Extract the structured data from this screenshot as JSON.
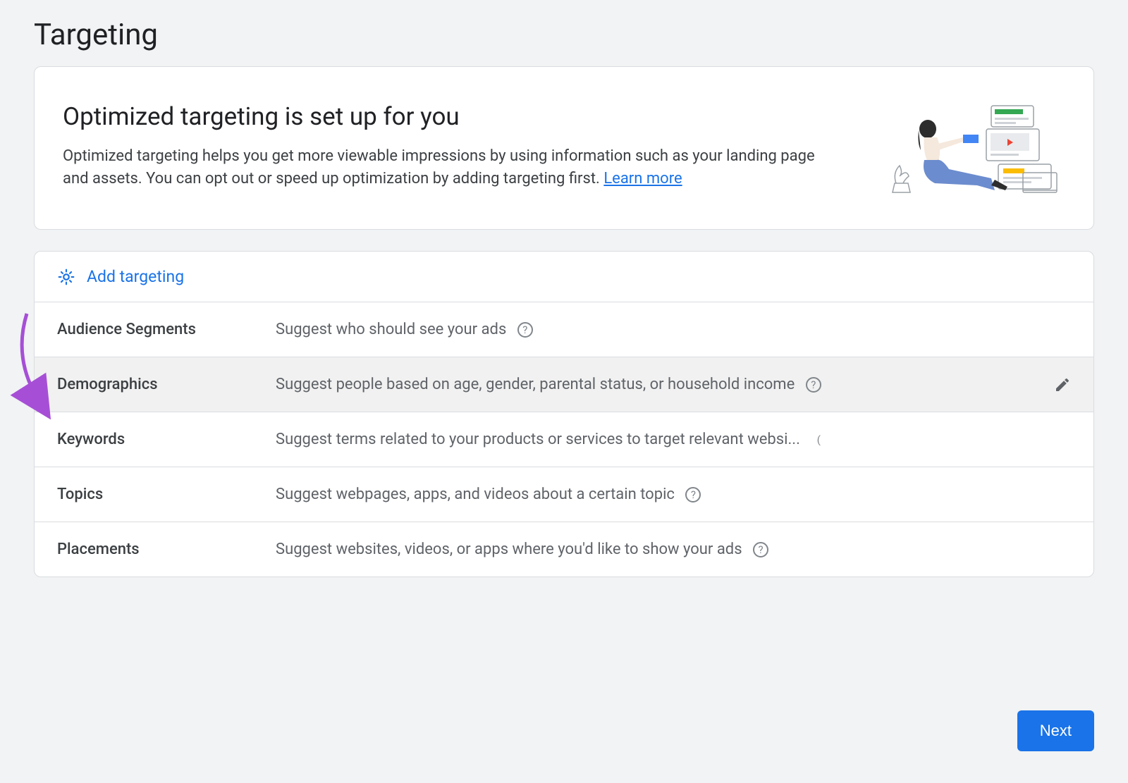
{
  "page_title": "Targeting",
  "card": {
    "title": "Optimized targeting is set up for you",
    "description": "Optimized targeting helps you get more viewable impressions by using information such as your landing page and assets. You can opt out or speed up optimization by adding targeting first. ",
    "learn_more": "Learn more"
  },
  "add_targeting": {
    "label": "Add targeting"
  },
  "rows": [
    {
      "label": "Audience Segments",
      "desc": "Suggest who should see your ads",
      "highlighted": false,
      "has_pencil": false
    },
    {
      "label": "Demographics",
      "desc": "Suggest people based on age, gender, parental status, or household income",
      "highlighted": true,
      "has_pencil": true
    },
    {
      "label": "Keywords",
      "desc": "Suggest terms related to your products or services to target relevant websi...",
      "highlighted": false,
      "has_pencil": false
    },
    {
      "label": "Topics",
      "desc": "Suggest webpages, apps, and videos about a certain topic",
      "highlighted": false,
      "has_pencil": false
    },
    {
      "label": "Placements",
      "desc": "Suggest websites, videos, or apps where you'd like to show your ads",
      "highlighted": false,
      "has_pencil": false
    }
  ],
  "next_button": "Next",
  "colors": {
    "link": "#1a73e8",
    "arrow": "#a64fd6"
  }
}
